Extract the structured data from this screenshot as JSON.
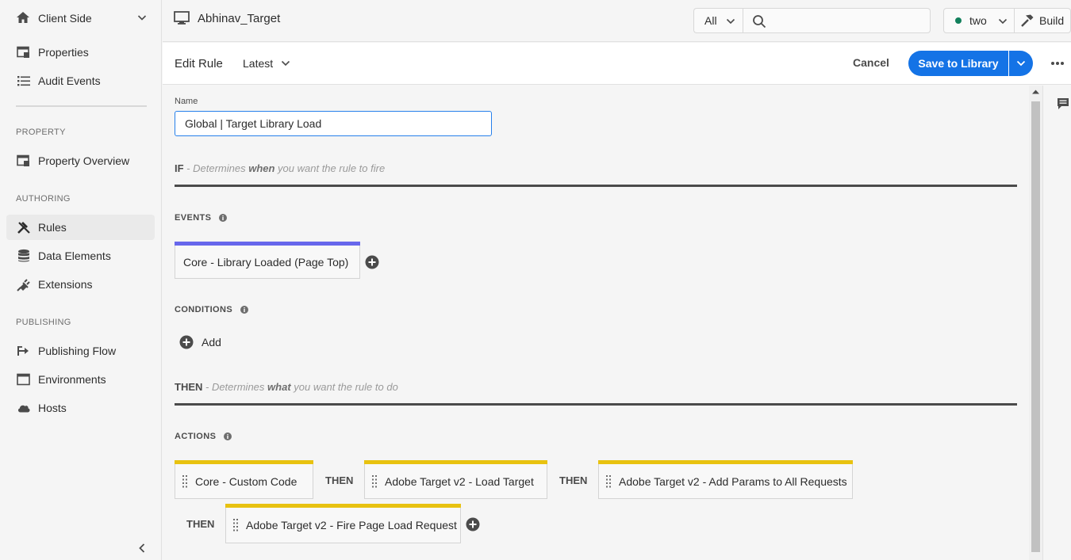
{
  "sidebar": {
    "company": "Client Side",
    "items_top": [
      {
        "label": "Properties",
        "icon": "properties-icon"
      },
      {
        "label": "Audit Events",
        "icon": "list-icon"
      }
    ],
    "section_property": "PROPERTY",
    "item_overview": "Property Overview",
    "section_authoring": "AUTHORING",
    "authoring_items": [
      {
        "label": "Rules",
        "icon": "rules-icon",
        "active": true
      },
      {
        "label": "Data Elements",
        "icon": "database-icon"
      },
      {
        "label": "Extensions",
        "icon": "plug-icon"
      }
    ],
    "section_publishing": "PUBLISHING",
    "publishing_items": [
      {
        "label": "Publishing Flow",
        "icon": "publish-flow-icon"
      },
      {
        "label": "Environments",
        "icon": "window-icon"
      },
      {
        "label": "Hosts",
        "icon": "cloud-icon"
      }
    ]
  },
  "topbar": {
    "property_name": "Abhinav_Target",
    "scope": "All",
    "search_placeholder": "",
    "library": "two",
    "library_status_color": "#12805c",
    "build": "Build"
  },
  "actionbar": {
    "title": "Edit Rule",
    "revision": "Latest",
    "cancel": "Cancel",
    "save": "Save to Library",
    "accent": "#1473e6"
  },
  "rule": {
    "name_label": "Name",
    "name_value": "Global | Target Library Load",
    "if_kw": "IF",
    "if_desc_a": " - Determines ",
    "if_desc_em": "when",
    "if_desc_b": " you want the rule to fire",
    "events_label": "EVENTS",
    "events": [
      {
        "label": "Core - Library Loaded (Page Top)",
        "color": "#6767ec"
      }
    ],
    "conditions_label": "CONDITIONS",
    "add_label": "Add",
    "then_kw": "THEN",
    "then_desc_a": " - Determines ",
    "then_desc_em": "what",
    "then_desc_b": " you want the rule to do",
    "actions_label": "ACTIONS",
    "actions": [
      {
        "label": "Core - Custom Code"
      },
      {
        "label": "Adobe Target v2 - Load Target"
      },
      {
        "label": "Adobe Target v2 - Add Params to All Requests"
      },
      {
        "label": "Adobe Target v2 - Fire Page Load Request"
      }
    ],
    "action_color": "#e8c210",
    "then_sep": "THEN"
  }
}
